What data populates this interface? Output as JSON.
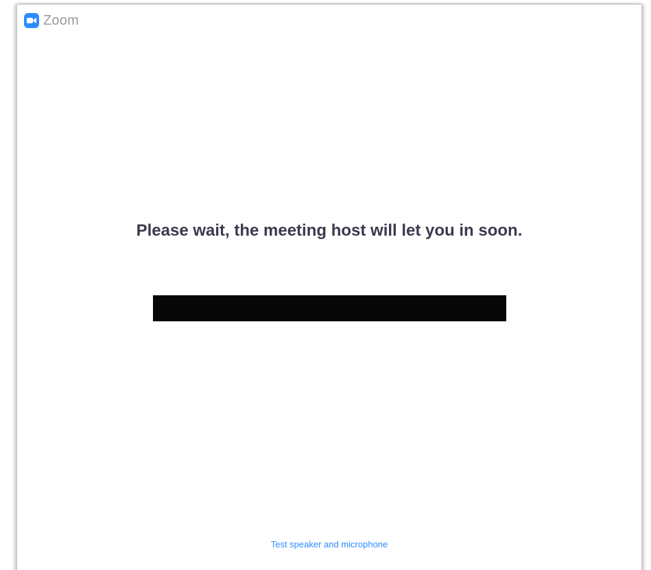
{
  "window": {
    "app_title": "Zoom",
    "app_icon": "zoom-camera-icon",
    "brand_color": "#2d8cff"
  },
  "waiting_room": {
    "message": "Please wait, the meeting host will let you in soon.",
    "test_audio_link": "Test speaker and microphone"
  }
}
